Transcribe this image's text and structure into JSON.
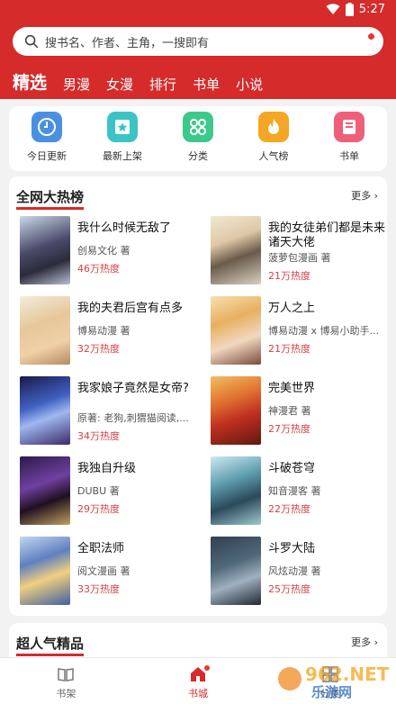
{
  "status": {
    "time": "5:27"
  },
  "search": {
    "placeholder": "搜书名、作者、主角，一搜即有"
  },
  "tabs": [
    {
      "label": "精选",
      "active": true
    },
    {
      "label": "男漫"
    },
    {
      "label": "女漫"
    },
    {
      "label": "排行"
    },
    {
      "label": "书单"
    },
    {
      "label": "小说"
    }
  ],
  "quicknav": [
    {
      "label": "今日更新",
      "icon": "clock-icon"
    },
    {
      "label": "最新上架",
      "icon": "star-box-icon"
    },
    {
      "label": "分类",
      "icon": "grid-icon"
    },
    {
      "label": "人气榜",
      "icon": "flame-icon"
    },
    {
      "label": "书单",
      "icon": "book-icon"
    }
  ],
  "hot": {
    "title": "全网大热榜",
    "more": "更多",
    "books": [
      {
        "title": "我什么时候无敌了",
        "author": "创易文化 著",
        "heat": "46万热度"
      },
      {
        "title": "我的女徒弟们都是未来诸天大佬",
        "author": "菠萝包漫画 著",
        "heat": "21万热度"
      },
      {
        "title": "我的夫君后宫有点多",
        "author": "博易动漫 著",
        "heat": "32万热度"
      },
      {
        "title": "万人之上",
        "author": "博易动漫 x 博易小助手...",
        "heat": "21万热度"
      },
      {
        "title": "我家娘子竟然是女帝?",
        "author": "原著: 老狗,刺猬猫阅读,...",
        "heat": "34万热度"
      },
      {
        "title": "完美世界",
        "author": "神漫君 著",
        "heat": "27万热度"
      },
      {
        "title": "我独自升级",
        "author": "DUBU 著",
        "heat": "29万热度"
      },
      {
        "title": "斗破苍穹",
        "author": "知音漫客 著",
        "heat": "22万热度"
      },
      {
        "title": "全职法师",
        "author": "阅文漫画 著",
        "heat": "33万热度"
      },
      {
        "title": "斗罗大陆",
        "author": "风炫动漫 著",
        "heat": "25万热度"
      }
    ]
  },
  "section2": {
    "title": "超人气精品",
    "more": "更多"
  },
  "bottomnav": [
    {
      "label": "书架",
      "icon": "bookshelf-icon"
    },
    {
      "label": "书城",
      "icon": "home-icon",
      "active": true
    },
    {
      "label": "分类",
      "icon": "category-icon"
    }
  ],
  "colors": {
    "brand": "#d52b2b",
    "heat": "#d94040"
  }
}
